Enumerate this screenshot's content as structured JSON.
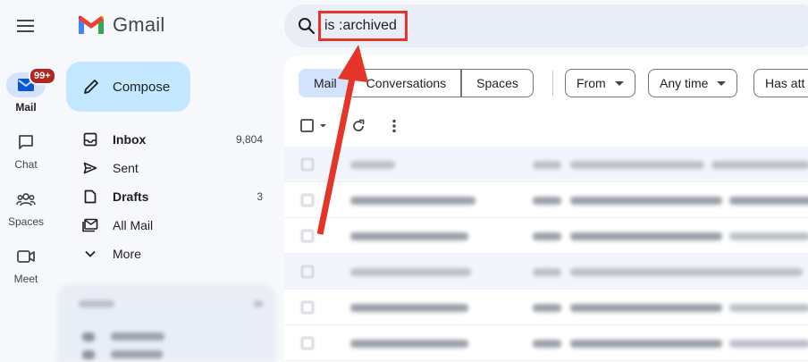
{
  "app": {
    "name": "Gmail"
  },
  "rail": {
    "items": [
      {
        "label": "Mail",
        "badge": "99+",
        "active": true,
        "icon": "mail-icon"
      },
      {
        "label": "Chat",
        "icon": "chat-icon"
      },
      {
        "label": "Spaces",
        "icon": "spaces-icon"
      },
      {
        "label": "Meet",
        "icon": "meet-icon"
      }
    ]
  },
  "compose": {
    "label": "Compose"
  },
  "nav": {
    "items": [
      {
        "label": "Inbox",
        "count": "9,804",
        "bold": true,
        "icon": "inbox-icon"
      },
      {
        "label": "Sent",
        "count": "",
        "bold": false,
        "icon": "send-icon"
      },
      {
        "label": "Drafts",
        "count": "3",
        "bold": true,
        "icon": "draft-icon"
      },
      {
        "label": "All Mail",
        "count": "",
        "bold": false,
        "icon": "all-mail-icon"
      },
      {
        "label": "More",
        "count": "",
        "bold": false,
        "icon": "chevron-down-icon"
      }
    ]
  },
  "search": {
    "value": "is :archived"
  },
  "filters": {
    "segments": [
      "Mail",
      "Conversations",
      "Spaces"
    ],
    "chips": [
      "From",
      "Any time",
      "Has att"
    ]
  },
  "colors": {
    "accent": "#d3e3fd",
    "compose": "#c2e7ff",
    "annotation": "#e53529",
    "badge": "#b3261e"
  }
}
